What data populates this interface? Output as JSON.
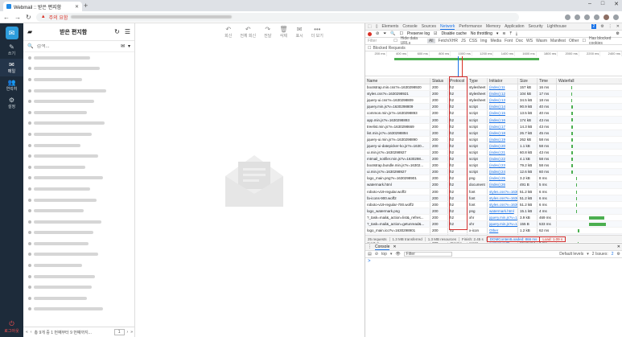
{
  "browser": {
    "tab_title": "Webmail :: 받은 편지함",
    "url_warning": "주의 요함",
    "new_tab": "+"
  },
  "sidebar": {
    "items": [
      {
        "icon": "pencil-icon",
        "label": "쓰기"
      },
      {
        "icon": "mail-icon",
        "label": "메일"
      },
      {
        "icon": "users-icon",
        "label": "연락처"
      },
      {
        "icon": "gear-icon",
        "label": "설정"
      }
    ],
    "logout": "로그아웃"
  },
  "maillist": {
    "title": "받은 편지함",
    "search_placeholder": "검색...",
    "footer_text": "총 9개 중 1 번째부터 9 번째까지...",
    "page": "1"
  },
  "viewer_toolbar": {
    "reply": "회신",
    "reply_all": "전체 회신",
    "forward": "전달",
    "delete": "삭제",
    "mark": "표시",
    "more": "더 보기"
  },
  "devtools": {
    "tabs": [
      "Elements",
      "Console",
      "Sources",
      "Network",
      "Performance",
      "Memory",
      "Application",
      "Security",
      "Lighthouse"
    ],
    "active_tab": "Network",
    "badge_count": "2",
    "toolbar": {
      "preserve_log": "Preserve log",
      "disable_cache": "Disable cache",
      "throttling": "No throttling"
    },
    "filter": {
      "placeholder": "Filter",
      "hide_data_urls": "Hide data URLs",
      "types": [
        "All",
        "Fetch/XHR",
        "JS",
        "CSS",
        "Img",
        "Media",
        "Font",
        "Doc",
        "WS",
        "Wasm",
        "Manifest",
        "Other"
      ],
      "blocked_cookies": "Has blocked cookies"
    },
    "blocked_requests": "Blocked Requests",
    "timeline_ticks": [
      "200 ms",
      "400 ms",
      "600 ms",
      "800 ms",
      "1000 ms",
      "1200 ms",
      "1400 ms",
      "1600 ms",
      "1800 ms",
      "2000 ms",
      "2200 ms",
      "2400 ms"
    ],
    "columns": [
      "Name",
      "Status",
      "Protocol",
      "Type",
      "Initiator",
      "Size",
      "Time",
      "Waterfall"
    ],
    "rows": [
      {
        "name": "bootstrap.min.css?v=1630298920",
        "status": "200",
        "protocol": "h2",
        "type": "stylesheet",
        "initiator": "(index):11",
        "size": "157 kB",
        "time": "16 ms"
      },
      {
        "name": "styles.css?v=1630298921",
        "status": "200",
        "protocol": "h2",
        "type": "stylesheet",
        "initiator": "(index):12",
        "size": "104 kB",
        "time": "17 ms"
      },
      {
        "name": "jquery-ui.css?v=1630298809",
        "status": "200",
        "protocol": "h2",
        "type": "stylesheet",
        "initiator": "(index):13",
        "size": "34.5 kB",
        "time": "18 ms"
      },
      {
        "name": "jquery.min.js?v=1630298809",
        "status": "200",
        "protocol": "h2",
        "type": "script",
        "initiator": "(index):14",
        "size": "90.9 kB",
        "time": "40 ms"
      },
      {
        "name": "common.min.js?v=1630298893",
        "status": "200",
        "protocol": "h2",
        "type": "script",
        "initiator": "(index):15",
        "size": "13.5 kB",
        "time": "40 ms"
      },
      {
        "name": "app.min.js?v=1630298893",
        "status": "200",
        "protocol": "h2",
        "type": "script",
        "initiator": "(index):16",
        "size": "174 kB",
        "time": "43 ms"
      },
      {
        "name": "treelist.min.js?v=1630298669",
        "status": "200",
        "protocol": "h2",
        "type": "script",
        "initiator": "(index):17",
        "size": "14.3 kB",
        "time": "43 ms"
      },
      {
        "name": "list.min.js?v=1630298894",
        "status": "200",
        "protocol": "h2",
        "type": "script",
        "initiator": "(index):18",
        "size": "26.7 kB",
        "time": "45 ms"
      },
      {
        "name": "jquery-ui.min.js?v=1630298890",
        "status": "200",
        "protocol": "h2",
        "type": "script",
        "initiator": "(index):19",
        "size": "262 kB",
        "time": "58 ms"
      },
      {
        "name": "jquery-ui-datepicker-ko.js?v=1630...",
        "status": "200",
        "protocol": "h2",
        "type": "script",
        "initiator": "(index):20",
        "size": "1.1 kB",
        "time": "58 ms"
      },
      {
        "name": "ui.min.js?v=1630298927",
        "status": "200",
        "protocol": "h2",
        "type": "script",
        "initiator": "(index):21",
        "size": "60.8 kB",
        "time": "43 ms"
      },
      {
        "name": "mtmail_notifier.min.js?v=1630298...",
        "status": "200",
        "protocol": "h2",
        "type": "script",
        "initiator": "(index):22",
        "size": "4.1 kB",
        "time": "58 ms"
      },
      {
        "name": "bootstrap.bundle.min.js?v=16302...",
        "status": "200",
        "protocol": "h2",
        "type": "script",
        "initiator": "(index):23",
        "size": "79.2 kB",
        "time": "58 ms"
      },
      {
        "name": "ui.min.js?v=1630298927",
        "status": "200",
        "protocol": "h2",
        "type": "script",
        "initiator": "(index):24",
        "size": "12.6 kB",
        "time": "60 ms"
      },
      {
        "name": "logo_main.png?v=1630298901",
        "status": "200",
        "protocol": "h2",
        "type": "png",
        "initiator": "(index):25",
        "size": "3.2 kB",
        "time": "8 ms"
      },
      {
        "name": "watermark.html",
        "status": "200",
        "protocol": "h2",
        "type": "document",
        "initiator": "(index):26",
        "size": "491 B",
        "time": "5 ms"
      },
      {
        "name": "roboto-v19-regular.woff2",
        "status": "200",
        "protocol": "h2",
        "type": "font",
        "initiator": "styles.css?v=1630...",
        "size": "51.2 kB",
        "time": "6 ms"
      },
      {
        "name": "fa-icons-900.woff2",
        "status": "200",
        "protocol": "h2",
        "type": "font",
        "initiator": "styles.css?v=1630...",
        "size": "51.2 kB",
        "time": "6 ms"
      },
      {
        "name": "roboto-v19-regular-700.woff2",
        "status": "200",
        "protocol": "h2",
        "type": "font",
        "initiator": "styles.css?v=1630...",
        "size": "51.2 kB",
        "time": "6 ms"
      },
      {
        "name": "logo_watermark.png",
        "status": "200",
        "protocol": "h2",
        "type": "png",
        "initiator": "watermark.html",
        "size": "15.1 kB",
        "time": "4 ms"
      },
      {
        "name": "?_task=mail&_action=list&_refres...",
        "status": "200",
        "protocol": "h2",
        "type": "xhr",
        "initiator": "jquery.min.js?v=1...",
        "size": "3.9 kB",
        "time": "469 ms"
      },
      {
        "name": "?_task=mail&_action=getunread&...",
        "status": "200",
        "protocol": "h2",
        "type": "xhr",
        "initiator": "jquery.min.js?v=1...",
        "size": "155 B",
        "time": "533 ms"
      },
      {
        "name": "logo_main.ico?v=1630298901",
        "status": "200",
        "protocol": "h2",
        "type": "x-icon",
        "initiator": "Other",
        "size": "1.2 kB",
        "time": "62 ms"
      },
      {
        "name": "fa-regular-400.woff2",
        "status": "200",
        "protocol": "h2",
        "type": "font",
        "initiator": "styles.css?v=1630...",
        "size": "13.2 kB",
        "time": "19 ms"
      },
      {
        "name": "inject.js",
        "status": "200",
        "protocol": "chrome-...",
        "type": "script",
        "initiator": "content.js:35",
        "size": "(memory)",
        "time": "6 ms"
      }
    ],
    "summary": {
      "requests": "25 requests",
      "transferred": "1.3 MB transferred",
      "resources": "1.3 MB resources",
      "finish": "Finish: 2.45 s",
      "dom_content_loaded": "DOMContentLoaded: 866 ms",
      "load": "Load: 1.09 s"
    },
    "console": {
      "tab": "Console",
      "context": "top",
      "filter_placeholder": "Filter",
      "levels": "Default levels",
      "issues": "2 Issues:",
      "issues_count": "2",
      "prompt": ">"
    }
  }
}
